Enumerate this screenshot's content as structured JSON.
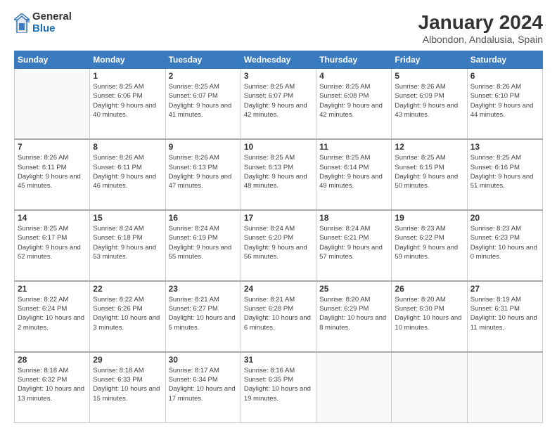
{
  "header": {
    "logo_general": "General",
    "logo_blue": "Blue",
    "month_year": "January 2024",
    "location": "Albondon, Andalusia, Spain"
  },
  "days_of_week": [
    "Sunday",
    "Monday",
    "Tuesday",
    "Wednesday",
    "Thursday",
    "Friday",
    "Saturday"
  ],
  "weeks": [
    [
      {
        "day": "",
        "sunrise": "",
        "sunset": "",
        "daylight": "",
        "empty": true
      },
      {
        "day": "1",
        "sunrise": "Sunrise: 8:25 AM",
        "sunset": "Sunset: 6:06 PM",
        "daylight": "Daylight: 9 hours and 40 minutes."
      },
      {
        "day": "2",
        "sunrise": "Sunrise: 8:25 AM",
        "sunset": "Sunset: 6:07 PM",
        "daylight": "Daylight: 9 hours and 41 minutes."
      },
      {
        "day": "3",
        "sunrise": "Sunrise: 8:25 AM",
        "sunset": "Sunset: 6:07 PM",
        "daylight": "Daylight: 9 hours and 42 minutes."
      },
      {
        "day": "4",
        "sunrise": "Sunrise: 8:25 AM",
        "sunset": "Sunset: 6:08 PM",
        "daylight": "Daylight: 9 hours and 42 minutes."
      },
      {
        "day": "5",
        "sunrise": "Sunrise: 8:26 AM",
        "sunset": "Sunset: 6:09 PM",
        "daylight": "Daylight: 9 hours and 43 minutes."
      },
      {
        "day": "6",
        "sunrise": "Sunrise: 8:26 AM",
        "sunset": "Sunset: 6:10 PM",
        "daylight": "Daylight: 9 hours and 44 minutes."
      }
    ],
    [
      {
        "day": "7",
        "sunrise": "Sunrise: 8:26 AM",
        "sunset": "Sunset: 6:11 PM",
        "daylight": "Daylight: 9 hours and 45 minutes."
      },
      {
        "day": "8",
        "sunrise": "Sunrise: 8:26 AM",
        "sunset": "Sunset: 6:11 PM",
        "daylight": "Daylight: 9 hours and 46 minutes."
      },
      {
        "day": "9",
        "sunrise": "Sunrise: 8:26 AM",
        "sunset": "Sunset: 6:13 PM",
        "daylight": "Daylight: 9 hours and 47 minutes."
      },
      {
        "day": "10",
        "sunrise": "Sunrise: 8:25 AM",
        "sunset": "Sunset: 6:13 PM",
        "daylight": "Daylight: 9 hours and 48 minutes."
      },
      {
        "day": "11",
        "sunrise": "Sunrise: 8:25 AM",
        "sunset": "Sunset: 6:14 PM",
        "daylight": "Daylight: 9 hours and 49 minutes."
      },
      {
        "day": "12",
        "sunrise": "Sunrise: 8:25 AM",
        "sunset": "Sunset: 6:15 PM",
        "daylight": "Daylight: 9 hours and 50 minutes."
      },
      {
        "day": "13",
        "sunrise": "Sunrise: 8:25 AM",
        "sunset": "Sunset: 6:16 PM",
        "daylight": "Daylight: 9 hours and 51 minutes."
      }
    ],
    [
      {
        "day": "14",
        "sunrise": "Sunrise: 8:25 AM",
        "sunset": "Sunset: 6:17 PM",
        "daylight": "Daylight: 9 hours and 52 minutes."
      },
      {
        "day": "15",
        "sunrise": "Sunrise: 8:24 AM",
        "sunset": "Sunset: 6:18 PM",
        "daylight": "Daylight: 9 hours and 53 minutes."
      },
      {
        "day": "16",
        "sunrise": "Sunrise: 8:24 AM",
        "sunset": "Sunset: 6:19 PM",
        "daylight": "Daylight: 9 hours and 55 minutes."
      },
      {
        "day": "17",
        "sunrise": "Sunrise: 8:24 AM",
        "sunset": "Sunset: 6:20 PM",
        "daylight": "Daylight: 9 hours and 56 minutes."
      },
      {
        "day": "18",
        "sunrise": "Sunrise: 8:24 AM",
        "sunset": "Sunset: 6:21 PM",
        "daylight": "Daylight: 9 hours and 57 minutes."
      },
      {
        "day": "19",
        "sunrise": "Sunrise: 8:23 AM",
        "sunset": "Sunset: 6:22 PM",
        "daylight": "Daylight: 9 hours and 59 minutes."
      },
      {
        "day": "20",
        "sunrise": "Sunrise: 8:23 AM",
        "sunset": "Sunset: 6:23 PM",
        "daylight": "Daylight: 10 hours and 0 minutes."
      }
    ],
    [
      {
        "day": "21",
        "sunrise": "Sunrise: 8:22 AM",
        "sunset": "Sunset: 6:24 PM",
        "daylight": "Daylight: 10 hours and 2 minutes."
      },
      {
        "day": "22",
        "sunrise": "Sunrise: 8:22 AM",
        "sunset": "Sunset: 6:26 PM",
        "daylight": "Daylight: 10 hours and 3 minutes."
      },
      {
        "day": "23",
        "sunrise": "Sunrise: 8:21 AM",
        "sunset": "Sunset: 6:27 PM",
        "daylight": "Daylight: 10 hours and 5 minutes."
      },
      {
        "day": "24",
        "sunrise": "Sunrise: 8:21 AM",
        "sunset": "Sunset: 6:28 PM",
        "daylight": "Daylight: 10 hours and 6 minutes."
      },
      {
        "day": "25",
        "sunrise": "Sunrise: 8:20 AM",
        "sunset": "Sunset: 6:29 PM",
        "daylight": "Daylight: 10 hours and 8 minutes."
      },
      {
        "day": "26",
        "sunrise": "Sunrise: 8:20 AM",
        "sunset": "Sunset: 6:30 PM",
        "daylight": "Daylight: 10 hours and 10 minutes."
      },
      {
        "day": "27",
        "sunrise": "Sunrise: 8:19 AM",
        "sunset": "Sunset: 6:31 PM",
        "daylight": "Daylight: 10 hours and 11 minutes."
      }
    ],
    [
      {
        "day": "28",
        "sunrise": "Sunrise: 8:18 AM",
        "sunset": "Sunset: 6:32 PM",
        "daylight": "Daylight: 10 hours and 13 minutes."
      },
      {
        "day": "29",
        "sunrise": "Sunrise: 8:18 AM",
        "sunset": "Sunset: 6:33 PM",
        "daylight": "Daylight: 10 hours and 15 minutes."
      },
      {
        "day": "30",
        "sunrise": "Sunrise: 8:17 AM",
        "sunset": "Sunset: 6:34 PM",
        "daylight": "Daylight: 10 hours and 17 minutes."
      },
      {
        "day": "31",
        "sunrise": "Sunrise: 8:16 AM",
        "sunset": "Sunset: 6:35 PM",
        "daylight": "Daylight: 10 hours and 19 minutes."
      },
      {
        "day": "",
        "sunrise": "",
        "sunset": "",
        "daylight": "",
        "empty": true
      },
      {
        "day": "",
        "sunrise": "",
        "sunset": "",
        "daylight": "",
        "empty": true
      },
      {
        "day": "",
        "sunrise": "",
        "sunset": "",
        "daylight": "",
        "empty": true
      }
    ]
  ]
}
